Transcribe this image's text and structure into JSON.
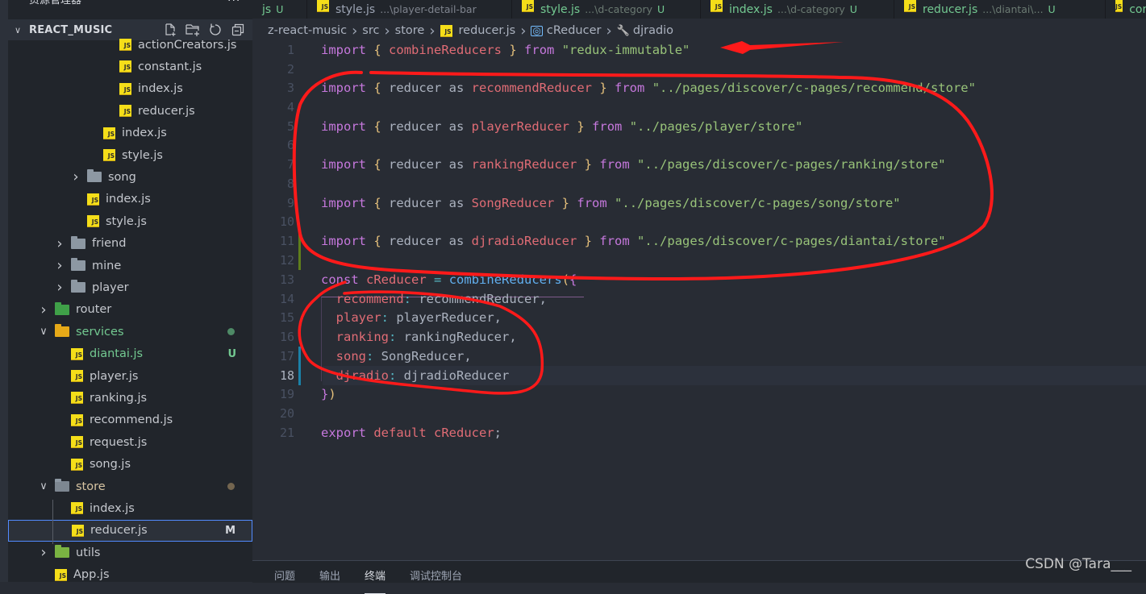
{
  "sidebar": {
    "title": "资源管理器",
    "more": "···",
    "project": "REACT_MUSIC",
    "actions": [
      "new-file-icon",
      "new-folder-icon",
      "refresh-icon",
      "collapse-all-icon"
    ],
    "items": [
      {
        "label": "actionCreators.js",
        "type": "js",
        "indent": 4
      },
      {
        "label": "constant.js",
        "type": "js",
        "indent": 4
      },
      {
        "label": "index.js",
        "type": "js",
        "indent": 4
      },
      {
        "label": "reducer.js",
        "type": "js",
        "indent": 4
      },
      {
        "label": "index.js",
        "type": "js",
        "indent": 3
      },
      {
        "label": "style.js",
        "type": "js",
        "indent": 3
      },
      {
        "label": "song",
        "type": "folder",
        "indent": 2,
        "expanded": false
      },
      {
        "label": "index.js",
        "type": "js",
        "indent": 2
      },
      {
        "label": "style.js",
        "type": "js",
        "indent": 2
      },
      {
        "label": "friend",
        "type": "folder",
        "indent": 1,
        "expanded": false
      },
      {
        "label": "mine",
        "type": "folder",
        "indent": 1,
        "expanded": false
      },
      {
        "label": "player",
        "type": "folder",
        "indent": 1,
        "expanded": false
      },
      {
        "label": "router",
        "type": "folder-router",
        "indent": 0,
        "expanded": false
      },
      {
        "label": "services",
        "type": "folder-services",
        "indent": 0,
        "expanded": true,
        "dot": "#4e8a66",
        "color": "#73c991"
      },
      {
        "label": "diantai.js",
        "type": "js",
        "indent": 1,
        "badge": "U",
        "color": "#73c991"
      },
      {
        "label": "player.js",
        "type": "js",
        "indent": 1
      },
      {
        "label": "ranking.js",
        "type": "js",
        "indent": 1
      },
      {
        "label": "recommend.js",
        "type": "js",
        "indent": 1
      },
      {
        "label": "request.js",
        "type": "js",
        "indent": 1
      },
      {
        "label": "song.js",
        "type": "js",
        "indent": 1
      },
      {
        "label": "store",
        "type": "folder-open",
        "indent": 0,
        "expanded": true,
        "dot": "#73654f",
        "color": "#d7c4a2"
      },
      {
        "label": "index.js",
        "type": "js",
        "indent": 1
      },
      {
        "label": "reducer.js",
        "type": "js",
        "indent": 1,
        "badge": "M",
        "selected": true
      },
      {
        "label": "utils",
        "type": "folder-utils",
        "indent": 0,
        "expanded": false
      },
      {
        "label": "App.js",
        "type": "js",
        "indent": 0
      }
    ]
  },
  "tabs": [
    {
      "name": "js",
      "desc": "",
      "status": "U"
    },
    {
      "name": "style.js",
      "desc": "...\\player-detail-bar",
      "status": "",
      "grey": true
    },
    {
      "name": "style.js",
      "desc": "...\\d-category",
      "status": "U"
    },
    {
      "name": "index.js",
      "desc": "...\\d-category",
      "status": "U"
    },
    {
      "name": "reducer.js",
      "desc": "...\\diantai\\...",
      "status": "U"
    },
    {
      "name": "cons",
      "desc": "",
      "status": ""
    }
  ],
  "breadcrumb": {
    "items": [
      "z-react-music",
      "src",
      "store",
      "reducer.js",
      "cReducer",
      "djradio"
    ]
  },
  "editor": {
    "current_line": 18,
    "lines": [
      {
        "n": 1,
        "tokens": [
          [
            "k",
            "import"
          ],
          [
            "p",
            " "
          ],
          [
            "b",
            "{"
          ],
          [
            "p",
            " "
          ],
          [
            "v",
            "combineReducers"
          ],
          [
            "p",
            " "
          ],
          [
            "b",
            "}"
          ],
          [
            "p",
            " "
          ],
          [
            "k",
            "from"
          ],
          [
            "p",
            " "
          ],
          [
            "s",
            "\"redux-immutable\""
          ]
        ]
      },
      {
        "n": 2,
        "tokens": []
      },
      {
        "n": 3,
        "tokens": [
          [
            "k",
            "import"
          ],
          [
            "p",
            " "
          ],
          [
            "b",
            "{"
          ],
          [
            "p",
            " reducer as "
          ],
          [
            "v",
            "recommendReducer"
          ],
          [
            "p",
            " "
          ],
          [
            "b",
            "}"
          ],
          [
            "p",
            " "
          ],
          [
            "k",
            "from"
          ],
          [
            "p",
            " "
          ],
          [
            "s",
            "\"../pages/discover/c-pages/recommend/store\""
          ]
        ]
      },
      {
        "n": 4,
        "tokens": []
      },
      {
        "n": 5,
        "tokens": [
          [
            "k",
            "import"
          ],
          [
            "p",
            " "
          ],
          [
            "b",
            "{"
          ],
          [
            "p",
            " reducer as "
          ],
          [
            "v",
            "playerReducer"
          ],
          [
            "p",
            " "
          ],
          [
            "b",
            "}"
          ],
          [
            "p",
            " "
          ],
          [
            "k",
            "from"
          ],
          [
            "p",
            " "
          ],
          [
            "s",
            "\"../pages/player/store\""
          ]
        ]
      },
      {
        "n": 6,
        "tokens": []
      },
      {
        "n": 7,
        "tokens": [
          [
            "k",
            "import"
          ],
          [
            "p",
            " "
          ],
          [
            "b",
            "{"
          ],
          [
            "p",
            " reducer as "
          ],
          [
            "v",
            "rankingReducer"
          ],
          [
            "p",
            " "
          ],
          [
            "b",
            "}"
          ],
          [
            "p",
            " "
          ],
          [
            "k",
            "from"
          ],
          [
            "p",
            " "
          ],
          [
            "s",
            "\"../pages/discover/c-pages/ranking/store\""
          ]
        ]
      },
      {
        "n": 8,
        "tokens": []
      },
      {
        "n": 9,
        "tokens": [
          [
            "k",
            "import"
          ],
          [
            "p",
            " "
          ],
          [
            "b",
            "{"
          ],
          [
            "p",
            " reducer as "
          ],
          [
            "v",
            "SongReducer"
          ],
          [
            "p",
            " "
          ],
          [
            "b",
            "}"
          ],
          [
            "p",
            " "
          ],
          [
            "k",
            "from"
          ],
          [
            "p",
            " "
          ],
          [
            "s",
            "\"../pages/discover/c-pages/song/store\""
          ]
        ]
      },
      {
        "n": 10,
        "tokens": []
      },
      {
        "n": 11,
        "gutter": "#5f7e1c",
        "tokens": [
          [
            "k",
            "import"
          ],
          [
            "p",
            " "
          ],
          [
            "b",
            "{"
          ],
          [
            "p",
            " reducer as "
          ],
          [
            "v",
            "djradioReducer"
          ],
          [
            "p",
            " "
          ],
          [
            "b",
            "}"
          ],
          [
            "p",
            " "
          ],
          [
            "k",
            "from"
          ],
          [
            "p",
            " "
          ],
          [
            "s",
            "\"../pages/discover/c-pages/diantai/store\""
          ]
        ]
      },
      {
        "n": 12,
        "gutter": "#5f7e1c",
        "tokens": []
      },
      {
        "n": 13,
        "tokens": [
          [
            "k",
            "const"
          ],
          [
            "p",
            " "
          ],
          [
            "v",
            "cReducer"
          ],
          [
            "p",
            " "
          ],
          [
            "o",
            "="
          ],
          [
            "p",
            " "
          ],
          [
            "f",
            "combineReducers"
          ],
          [
            "b",
            "("
          ],
          [
            "pb",
            "{"
          ]
        ]
      },
      {
        "n": 14,
        "tokens": [
          [
            "p",
            "  "
          ],
          [
            "v",
            "recommend"
          ],
          [
            "o",
            ":"
          ],
          [
            "p",
            " recommendReducer,"
          ]
        ]
      },
      {
        "n": 15,
        "tokens": [
          [
            "p",
            "  "
          ],
          [
            "v",
            "player"
          ],
          [
            "o",
            ":"
          ],
          [
            "p",
            " playerReducer,"
          ]
        ]
      },
      {
        "n": 16,
        "tokens": [
          [
            "p",
            "  "
          ],
          [
            "v",
            "ranking"
          ],
          [
            "o",
            ":"
          ],
          [
            "p",
            " rankingReducer,"
          ]
        ]
      },
      {
        "n": 17,
        "gutter": "#1b81a8",
        "tokens": [
          [
            "p",
            "  "
          ],
          [
            "v",
            "song"
          ],
          [
            "o",
            ":"
          ],
          [
            "p",
            " SongReducer,"
          ]
        ]
      },
      {
        "n": 18,
        "gutter": "#1b81a8",
        "tokens": [
          [
            "p",
            "  "
          ],
          [
            "v",
            "djradio"
          ],
          [
            "o",
            ":"
          ],
          [
            "p",
            " djradioReducer"
          ]
        ]
      },
      {
        "n": 19,
        "tokens": [
          [
            "pb",
            "}"
          ],
          [
            "b",
            ")"
          ]
        ]
      },
      {
        "n": 20,
        "tokens": []
      },
      {
        "n": 21,
        "tokens": [
          [
            "k",
            "export"
          ],
          [
            "p",
            " "
          ],
          [
            "v",
            "default"
          ],
          [
            "p",
            " "
          ],
          [
            "v",
            "cReducer"
          ],
          [
            "p",
            ";"
          ]
        ]
      }
    ]
  },
  "panel": {
    "tabs": [
      "问题",
      "输出",
      "终端",
      "调试控制台"
    ],
    "active": "终端"
  },
  "annotations": {
    "color": "#ff1a1a",
    "arrow_target": "line-1",
    "circles": [
      "import-block",
      "combine-reducers-object"
    ]
  },
  "watermark": "CSDN @Tara___"
}
